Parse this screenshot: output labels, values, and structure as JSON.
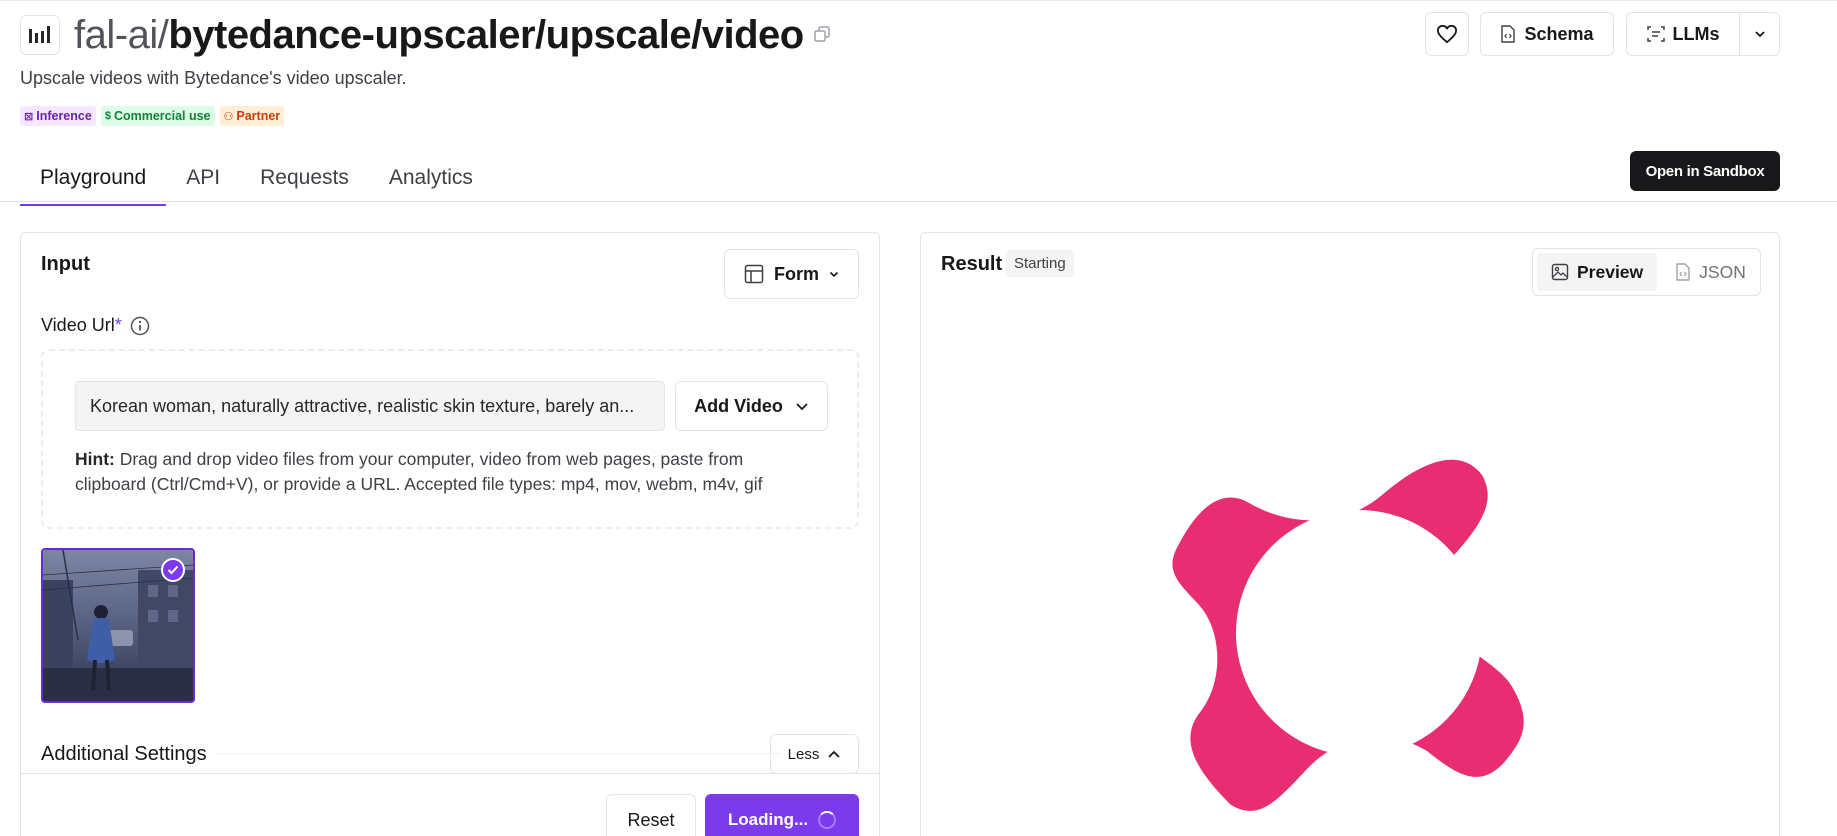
{
  "header": {
    "title_org": "fal-ai/",
    "title_path": "bytedance-upscaler/upscale/video",
    "subtitle": "Upscale videos with Bytedance's video upscaler.",
    "badges": [
      {
        "label": "Inference",
        "icon": "inference-icon"
      },
      {
        "label": "Commercial use",
        "icon": "dollar-icon"
      },
      {
        "label": "Partner",
        "icon": "partner-icon"
      }
    ],
    "buttons": {
      "favorite_icon": "heart-icon",
      "schema_label": "Schema",
      "llms_label": "LLMs"
    }
  },
  "tabs": [
    {
      "label": "Playground",
      "active": true
    },
    {
      "label": "API",
      "active": false
    },
    {
      "label": "Requests",
      "active": false
    },
    {
      "label": "Analytics",
      "active": false
    }
  ],
  "sandbox_label": "Open in Sandbox",
  "input_panel": {
    "title": "Input",
    "mode_label": "Form",
    "video_url": {
      "label": "Video Url",
      "required_mark": "*",
      "value": "Korean woman, naturally attractive, realistic skin texture, barely an...",
      "add_label": "Add Video",
      "hint_bold": "Hint:",
      "hint_text": " Drag and drop video files from your computer, video from web pages, paste from clipboard (Ctrl/Cmd+V), or provide a URL. Accepted file types: mp4, mov, webm, m4v, gif"
    },
    "additional_settings_label": "Additional Settings",
    "less_label": "Less",
    "reset_label": "Reset",
    "run_label": "Loading..."
  },
  "result_panel": {
    "title": "Result",
    "status": "Starting",
    "views": [
      {
        "label": "Preview",
        "active": true
      },
      {
        "label": "JSON",
        "active": false
      }
    ]
  },
  "colors": {
    "accent": "#7c3aed",
    "brand_pink": "#e92d72",
    "dark": "#18181b"
  }
}
